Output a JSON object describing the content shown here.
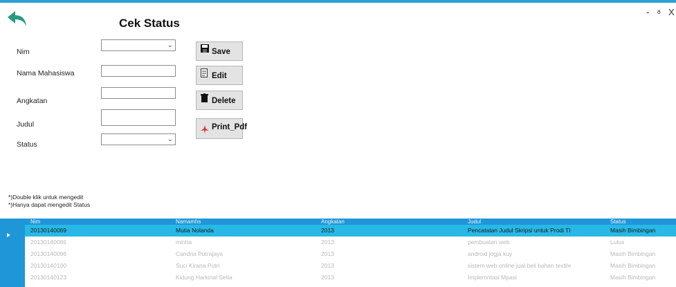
{
  "window": {
    "title": "Cek Status",
    "minimize": "-",
    "restore": "ᴕ",
    "close": "X"
  },
  "form": {
    "nim_label": "Nim",
    "nama_label": "Nama Mahasiswa",
    "angkatan_label": "Angkatan",
    "judul_label": "Judul",
    "status_label": "Status",
    "nim_value": "",
    "nama_value": "",
    "angkatan_value": "",
    "judul_value": "",
    "status_value": ""
  },
  "buttons": {
    "save": "Save",
    "edit": "Edit",
    "delete": "Delete",
    "print": "Print_Pdf"
  },
  "notes": {
    "line1": "*)Double klik untuk mengedit",
    "line2": "*)Hanya dapat mengedit Status"
  },
  "table": {
    "headers": [
      "Nim",
      "Namamhs",
      "Angkatan",
      "Judul",
      "Status"
    ],
    "rows": [
      [
        "20130140069",
        "Mutia Nolanda",
        "2013",
        "Pencatatan Judul Skripsi untuk Prodi TI",
        "Masih Bimbingan"
      ],
      [
        "20130140086",
        "minha",
        "2013",
        "pembuatan web",
        "Lulus"
      ],
      [
        "20130140096",
        "Candria Putrajaya",
        "2013",
        "android jogja kuy",
        "Masih Bimbingan"
      ],
      [
        "20130140100",
        "Suci Kirana Putri",
        "2013",
        "sistem web online jual beli bahan textile",
        "Masih Bimbingan"
      ],
      [
        "20130140123",
        "Kidung Harkinal Setia",
        "2013",
        "Implemntasi Mpasi",
        "Masih Bimbingan"
      ]
    ]
  },
  "colors": {
    "accent": "#1e96d8",
    "selected_row": "#27b8e6",
    "back_icon": "#2a9a7e"
  }
}
